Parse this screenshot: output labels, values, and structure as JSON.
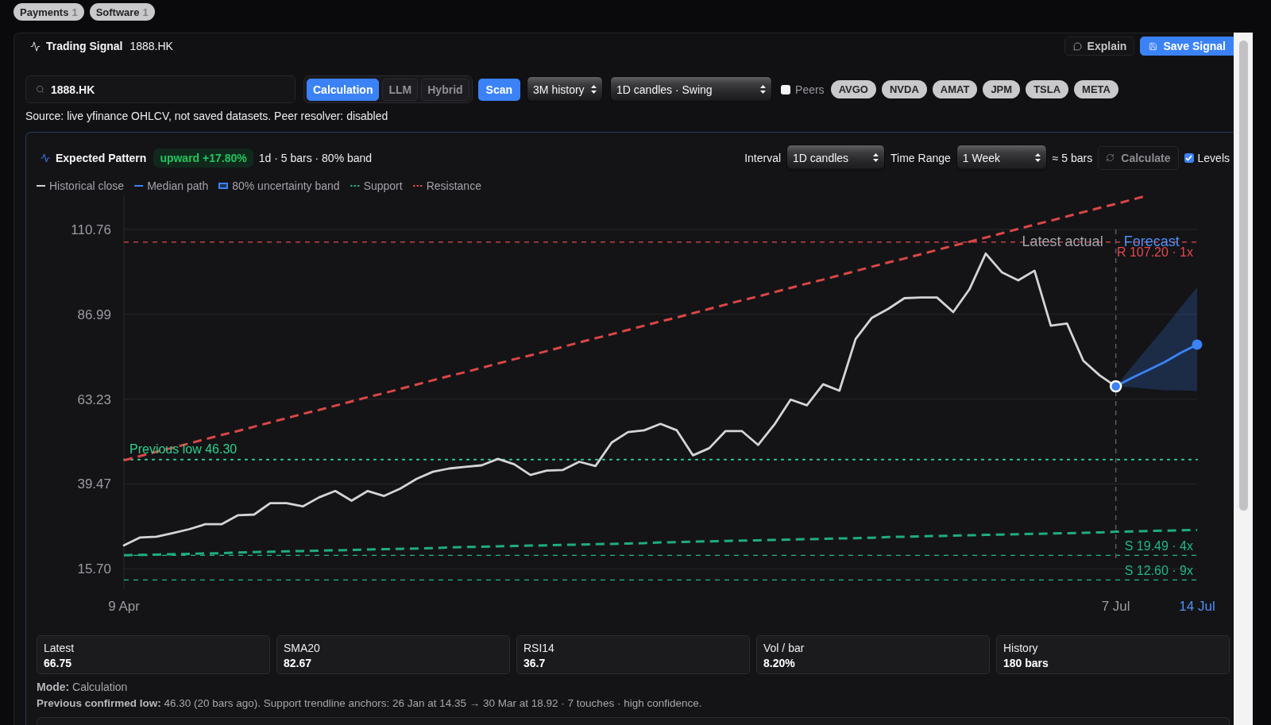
{
  "filters": [
    {
      "label": "Payments",
      "count": "1"
    },
    {
      "label": "Software",
      "count": "1"
    }
  ],
  "signal": {
    "title": "Trading Signal",
    "ticker": "1888.HK",
    "actions": [
      {
        "label": "Explain",
        "kind": "secondary"
      },
      {
        "label": "Save Signal",
        "kind": "primary"
      }
    ],
    "search": {
      "value": "1888.HK"
    },
    "modes": [
      {
        "label": "Calculation",
        "selected": true
      },
      {
        "label": "LLM",
        "selected": false
      },
      {
        "label": "Hybrid",
        "selected": false
      }
    ],
    "scan": "Scan",
    "selects": [
      {
        "value": "3M history"
      },
      {
        "value": "1D candles · Swing"
      }
    ],
    "peers": {
      "label": "Peers",
      "checked": false,
      "tickers": [
        "AVGO",
        "NVDA",
        "AMAT",
        "JPM",
        "TSLA",
        "META"
      ]
    },
    "source_note": "Source: live yfinance OHLCV, not saved datasets. Peer resolver: disabled"
  },
  "pattern": {
    "title": "Expected Pattern",
    "trend": {
      "label": "upward +17.80%",
      "kind": "up"
    },
    "summary": "1d · 5 bars · 80% band",
    "interval": {
      "label": "Interval",
      "value": "1D candles"
    },
    "time_range": {
      "label": "Time Range",
      "value": "1 Week"
    },
    "bars_estimate": "≈ 5 bars",
    "calculate": "Calculate",
    "levels": {
      "label": "Levels",
      "checked": true
    },
    "legend": [
      {
        "label": "Historical close",
        "kind": "line",
        "color": "#d4d4d6"
      },
      {
        "label": "Median path",
        "kind": "line",
        "color": "#3b82f6"
      },
      {
        "label": "80% uncertainty band",
        "kind": "band",
        "color": "#3b82f6"
      },
      {
        "label": "Support",
        "kind": "dashed",
        "color": "#1fae7c"
      },
      {
        "label": "Resistance",
        "kind": "dashed",
        "color": "#dc4646"
      }
    ],
    "chart_data": {
      "type": "line",
      "grid": true,
      "ylim": [
        10,
        120.3
      ],
      "yticks": [
        {
          "value": 15.7,
          "label": "15.70"
        },
        {
          "value": 39.47,
          "label": "39.47"
        },
        {
          "value": 63.23,
          "label": "63.23"
        },
        {
          "value": 86.99,
          "label": "86.99"
        },
        {
          "value": 110.76,
          "label": "110.76"
        }
      ],
      "categories": [
        "9 Apr",
        null,
        null,
        null,
        null,
        null,
        null,
        null,
        null,
        null,
        null,
        null,
        null,
        null,
        null,
        null,
        null,
        null,
        null,
        null,
        null,
        null,
        null,
        null,
        null,
        null,
        null,
        null,
        null,
        null,
        null,
        null,
        null,
        null,
        null,
        null,
        null,
        null,
        null,
        null,
        null,
        null,
        null,
        null,
        null,
        null,
        null,
        null,
        null,
        null,
        null,
        null,
        null,
        null,
        null,
        null,
        null,
        null,
        null,
        null,
        null,
        "7 Jul",
        null,
        null,
        null,
        null,
        "14 Jul"
      ],
      "series": [
        {
          "type": "line",
          "color": "#d4d4d6",
          "values": [
            22.3,
            24.5,
            24.7,
            25.7,
            26.8,
            28.2,
            28.2,
            30.7,
            30.9,
            34.1,
            34.1,
            33.2,
            35.7,
            37.5,
            34.8,
            37.5,
            36.1,
            38.2,
            40.9,
            42.9,
            43.8,
            44.3,
            44.7,
            46.5,
            45.0,
            42.0,
            43.2,
            43.4,
            45.7,
            44.5,
            51.1,
            54.0,
            54.5,
            56.3,
            54.5,
            47.5,
            49.5,
            54.3,
            54.3,
            50.4,
            56.1,
            63.1,
            61.5,
            67.4,
            65.6,
            80.1,
            86.0,
            88.5,
            91.5,
            91.7,
            91.7,
            87.6,
            94.0,
            104.0,
            98.7,
            96.5,
            99.2,
            83.8,
            84.4,
            74.0,
            69.9,
            66.8,
            null,
            null,
            null,
            null,
            null
          ]
        },
        {
          "type": "line",
          "color": "#3b82f6",
          "values": [
            null,
            null,
            null,
            null,
            null,
            null,
            null,
            null,
            null,
            null,
            null,
            null,
            null,
            null,
            null,
            null,
            null,
            null,
            null,
            null,
            null,
            null,
            null,
            null,
            null,
            null,
            null,
            null,
            null,
            null,
            null,
            null,
            null,
            null,
            null,
            null,
            null,
            null,
            null,
            null,
            null,
            null,
            null,
            null,
            null,
            null,
            null,
            null,
            null,
            null,
            null,
            null,
            null,
            null,
            null,
            null,
            null,
            null,
            null,
            null,
            null,
            66.8,
            69.2,
            71.4,
            73.6,
            76.2,
            78.5
          ]
        },
        {
          "type": "line",
          "line_style": "dashed",
          "color": "#1fae7c",
          "values": [
            19.5,
            19.6,
            19.7,
            19.8,
            19.9,
            20.0,
            20.1,
            20.3,
            20.4,
            20.5,
            20.6,
            20.7,
            20.8,
            20.9,
            21.0,
            21.1,
            21.2,
            21.3,
            21.4,
            21.5,
            21.7,
            21.8,
            21.9,
            22.0,
            22.1,
            22.2,
            22.3,
            22.4,
            22.5,
            22.6,
            22.7,
            22.8,
            22.9,
            23.1,
            23.2,
            23.3,
            23.4,
            23.5,
            23.6,
            23.7,
            23.8,
            23.9,
            24.0,
            24.1,
            24.2,
            24.3,
            24.4,
            24.6,
            24.7,
            24.8,
            24.9,
            25.0,
            25.1,
            25.2,
            25.3,
            25.4,
            25.5,
            25.6,
            25.7,
            25.8,
            25.9,
            26.1,
            26.2,
            26.3,
            26.4,
            26.5,
            26.6
          ]
        },
        {
          "type": "line",
          "line_style": "dashed",
          "color": "#dc4646",
          "values": [
            46.1,
            47.3,
            48.5,
            49.6,
            50.8,
            52.0,
            53.2,
            54.3,
            55.5,
            56.7,
            57.9,
            59.1,
            60.2,
            61.4,
            62.6,
            63.8,
            64.9,
            66.1,
            67.3,
            68.5,
            69.7,
            70.8,
            72.0,
            73.2,
            74.4,
            75.5,
            76.7,
            77.9,
            79.1,
            80.3,
            81.4,
            82.6,
            83.8,
            85.0,
            86.1,
            87.3,
            88.5,
            89.7,
            90.9,
            92.0,
            93.2,
            94.4,
            95.6,
            96.7,
            97.9,
            99.1,
            100.3,
            101.5,
            102.6,
            103.8,
            105.0,
            106.2,
            107.3,
            108.5,
            109.7,
            110.9,
            112.1,
            113.2,
            114.4,
            115.6,
            116.8,
            117.9,
            119.1,
            120.3,
            null,
            null,
            null
          ]
        },
        {
          "type": "scatter",
          "marker": "circle",
          "color": "#3b82f6",
          "values": [
            null,
            null,
            null,
            null,
            null,
            null,
            null,
            null,
            null,
            null,
            null,
            null,
            null,
            null,
            null,
            null,
            null,
            null,
            null,
            null,
            null,
            null,
            null,
            null,
            null,
            null,
            null,
            null,
            null,
            null,
            null,
            null,
            null,
            null,
            null,
            null,
            null,
            null,
            null,
            null,
            null,
            null,
            null,
            null,
            null,
            null,
            null,
            null,
            null,
            null,
            null,
            null,
            null,
            null,
            null,
            null,
            null,
            null,
            null,
            null,
            null,
            66.8,
            null,
            null,
            null,
            null,
            78.5
          ]
        }
      ],
      "ref_lines": [
        {
          "axis": "y",
          "value": 107.2,
          "label": "R 107.20 · 1x",
          "color": "#e5484d",
          "line_style": "dashed"
        },
        {
          "axis": "y",
          "value": 46.3,
          "label": "Previous low 46.30",
          "color": "#2fd08f",
          "line_style": "dotted"
        },
        {
          "axis": "y",
          "value": 19.49,
          "label": "S 19.49 · 4x",
          "color": "#22b882",
          "line_style": "dashed"
        },
        {
          "axis": "y",
          "value": 12.6,
          "label": "S 12.60 · 9x",
          "color": "#22b882",
          "line_style": "dashed"
        }
      ],
      "annotations": [
        "Latest actual",
        "Forecast"
      ]
    },
    "stats": [
      {
        "label": "Latest",
        "value": "66.75"
      },
      {
        "label": "SMA20",
        "value": "82.67"
      },
      {
        "label": "RSI14",
        "value": "36.7"
      },
      {
        "label": "Vol / bar",
        "value": "8.20%"
      },
      {
        "label": "History",
        "value": "180 bars"
      }
    ],
    "mode": "**Mode:** Calculation",
    "note": "**Previous confirmed low:** 46.30 (20 bars ago). Support trendline anchors: 26 Jan at 14.35 → 30 Mar at 18.92 · 7 touches · high confidence."
  }
}
